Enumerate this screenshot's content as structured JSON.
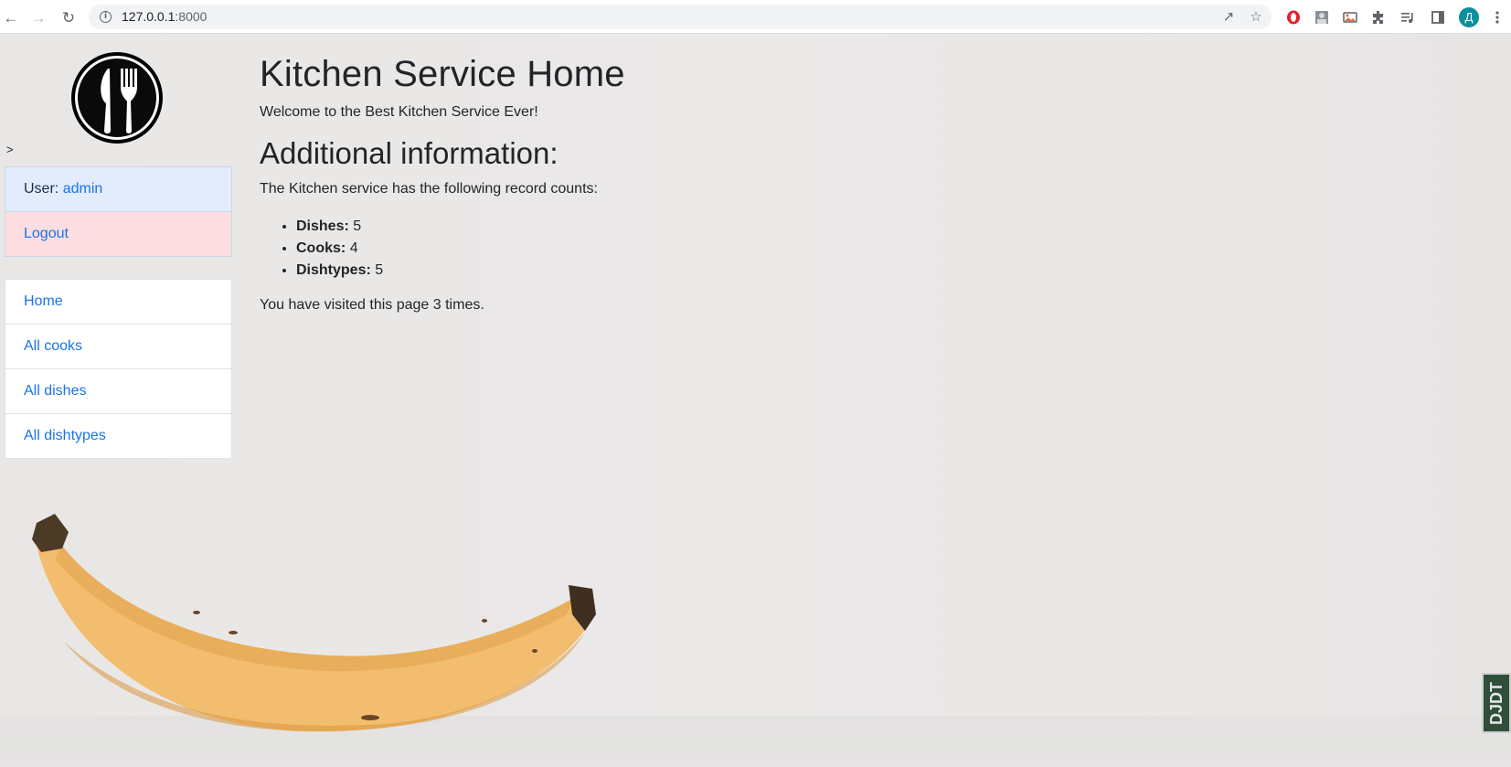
{
  "browser": {
    "url_host": "127.0.0.1",
    "url_port": ":8000",
    "avatar_letter": "Д"
  },
  "sidebar": {
    "marker": ">",
    "user_label": "User:",
    "user_name": "admin",
    "logout": "Logout",
    "menu": [
      {
        "label": "Home"
      },
      {
        "label": "All cooks"
      },
      {
        "label": "All dishes"
      },
      {
        "label": "All dishtypes"
      }
    ]
  },
  "main": {
    "title": "Kitchen Service Home",
    "welcome": "Welcome to the Best Kitchen Service Ever!",
    "subtitle": "Additional information:",
    "intro": "The Kitchen service has the following record counts:",
    "counts": [
      {
        "label": "Dishes:",
        "value": "5"
      },
      {
        "label": "Cooks:",
        "value": "4"
      },
      {
        "label": "Dishtypes:",
        "value": "5"
      }
    ],
    "visits": "You have visited this page 3 times."
  },
  "corner_badge": "DJDT",
  "colors": {
    "link": "#1a73e8",
    "user_bg": "#e2ecfd",
    "logout_bg": "#fcdde2"
  }
}
